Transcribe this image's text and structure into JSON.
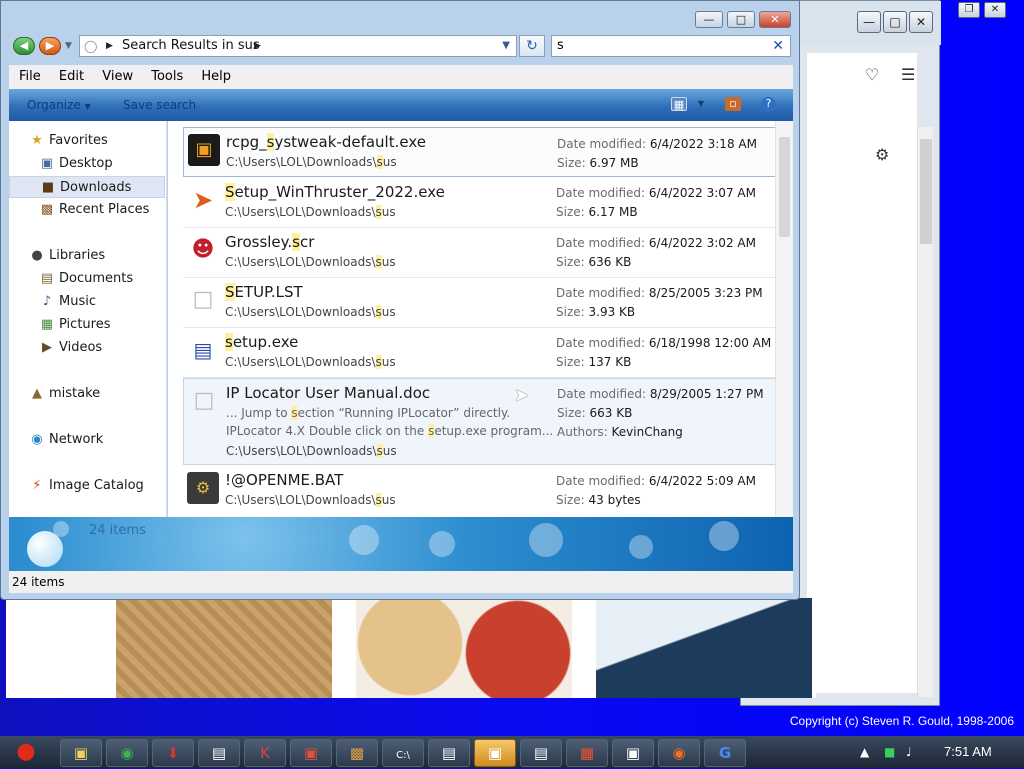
{
  "explorer": {
    "breadcrumb": "Search Results in sus",
    "search_value": "s",
    "menu": [
      "File",
      "Edit",
      "View",
      "Tools",
      "Help"
    ],
    "toolbar": {
      "organize": "Organize",
      "save_search": "Save search"
    },
    "nav": {
      "favorites": "Favorites",
      "desktop": "Desktop",
      "downloads": "Downloads",
      "recent_places": "Recent Places",
      "libraries": "Libraries",
      "documents": "Documents",
      "music": "Music",
      "pictures": "Pictures",
      "videos": "Videos",
      "mistake": "mistake",
      "network": "Network",
      "image_catalog": "Image Catalog"
    },
    "labels": {
      "date_modified": "Date modified:",
      "size": "Size:",
      "authors": "Authors:"
    },
    "files": [
      {
        "name": "rcpg_systweak-default.exe",
        "path": "C:\\Users\\LOL\\Downloads\\sus",
        "date": "6/4/2022 3:18 AM",
        "size": "6.97 MB"
      },
      {
        "name": "Setup_WinThruster_2022.exe",
        "path": "C:\\Users\\LOL\\Downloads\\sus",
        "date": "6/4/2022 3:07 AM",
        "size": "6.17 MB"
      },
      {
        "name": "Grossley.scr",
        "path": "C:\\Users\\LOL\\Downloads\\sus",
        "date": "6/4/2022 3:02 AM",
        "size": "636 KB"
      },
      {
        "name": "SETUP.LST",
        "path": "C:\\Users\\LOL\\Downloads\\sus",
        "date": "8/25/2005 3:23 PM",
        "size": "3.93 KB"
      },
      {
        "name": "setup.exe",
        "path": "C:\\Users\\LOL\\Downloads\\sus",
        "date": "6/18/1998 12:00 AM",
        "size": "137 KB"
      },
      {
        "name": "IP Locator User Manual.doc",
        "path": "C:\\Users\\LOL\\Downloads\\sus",
        "date": "8/29/2005 1:27 PM",
        "size": "663 KB",
        "authors": "KevinChang",
        "snippet1": "... Jump to section  “Running IPLocator”  directly.",
        "snippet2": "IPLocator 4.X Double click on the setup.exe program..."
      },
      {
        "name": "!@OPENME.BAT",
        "path": "C:\\Users\\LOL\\Downloads\\sus",
        "date": "6/4/2022 5:09 AM",
        "size": "43 bytes"
      }
    ],
    "details_count": "24 items",
    "status_count": "24 items"
  },
  "background": {
    "copyright": "Copyright (c) Steven R. Gould, 1998-2006"
  },
  "taskbar": {
    "clock": "7:51 AM"
  },
  "colors": {
    "desktop": "#0a0af0",
    "toolbar": "#2f6fb8",
    "highlight": "#fff0a0"
  }
}
